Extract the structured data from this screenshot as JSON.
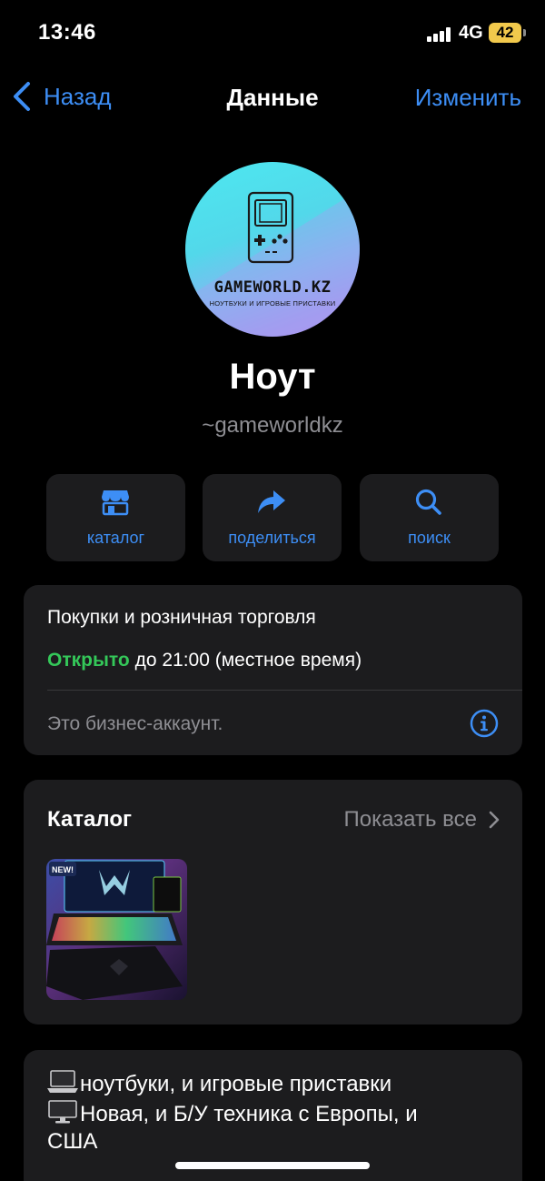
{
  "status_bar": {
    "time": "13:46",
    "network": "4G",
    "battery": "42"
  },
  "nav": {
    "back_label": "Назад",
    "title": "Данные",
    "edit_label": "Изменить"
  },
  "profile": {
    "avatar_brand": "GAMEWORLD.KZ",
    "avatar_tagline": "НОУТБУКИ И ИГРОВЫЕ ПРИСТАВКИ",
    "name": "Ноут",
    "username": "~gameworldkz"
  },
  "actions": [
    {
      "label": "каталог",
      "icon": "storefront-icon"
    },
    {
      "label": "поделиться",
      "icon": "share-arrow-icon"
    },
    {
      "label": "поиск",
      "icon": "magnifier-icon"
    }
  ],
  "business_info": {
    "category": "Покупки и розничная торговля",
    "open_status": "Открыто",
    "hours": "до 21:00 (местное время)",
    "note": "Это бизнес-аккаунт."
  },
  "catalog": {
    "title": "Каталог",
    "show_all": "Показать все",
    "items": [
      {
        "badge": "NEW!",
        "image": "gaming-laptop-product-photo"
      }
    ]
  },
  "description": {
    "lines": [
      "ноутбуки, и игровые приставки",
      "Новая, и Б/У техника с Европы, и",
      "США"
    ]
  },
  "colors": {
    "accent": "#3d8ef5",
    "open_green": "#34c759",
    "card_bg": "#1c1c1e",
    "secondary_text": "#8e8e93"
  }
}
